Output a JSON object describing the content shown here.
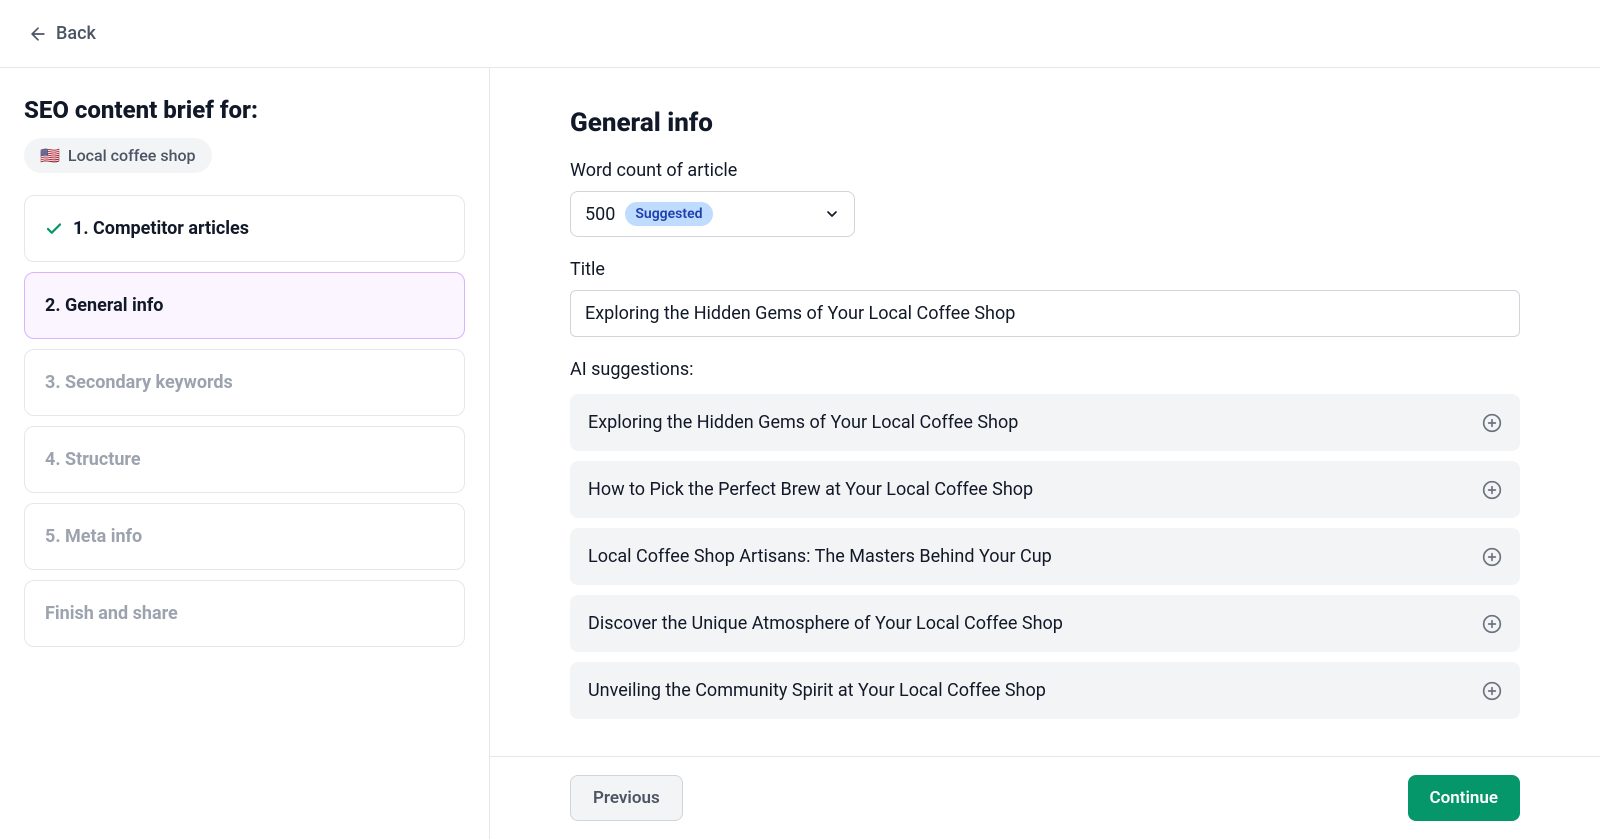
{
  "topbar": {
    "back_label": "Back"
  },
  "sidebar": {
    "title": "SEO content brief for:",
    "keyword": "Local coffee shop",
    "flag": "🇺🇸",
    "steps": [
      {
        "label": "1. Competitor articles",
        "state": "completed"
      },
      {
        "label": "2. General info",
        "state": "active"
      },
      {
        "label": "3. Secondary keywords",
        "state": "pending"
      },
      {
        "label": "4. Structure",
        "state": "pending"
      },
      {
        "label": "5. Meta info",
        "state": "pending"
      },
      {
        "label": "Finish and share",
        "state": "pending"
      }
    ]
  },
  "main": {
    "heading": "General info",
    "word_count_label": "Word count of article",
    "word_count_value": "500",
    "word_count_badge": "Suggested",
    "title_label": "Title",
    "title_value": "Exploring the Hidden Gems of Your Local Coffee Shop",
    "ai_suggestions_label": "AI suggestions:",
    "suggestions": [
      "Exploring the Hidden Gems of Your Local Coffee Shop",
      "How to Pick the Perfect Brew at Your Local Coffee Shop",
      "Local Coffee Shop Artisans: The Masters Behind Your Cup",
      "Discover the Unique Atmosphere of Your Local Coffee Shop",
      "Unveiling the Community Spirit at Your Local Coffee Shop"
    ]
  },
  "footer": {
    "previous_label": "Previous",
    "continue_label": "Continue"
  }
}
